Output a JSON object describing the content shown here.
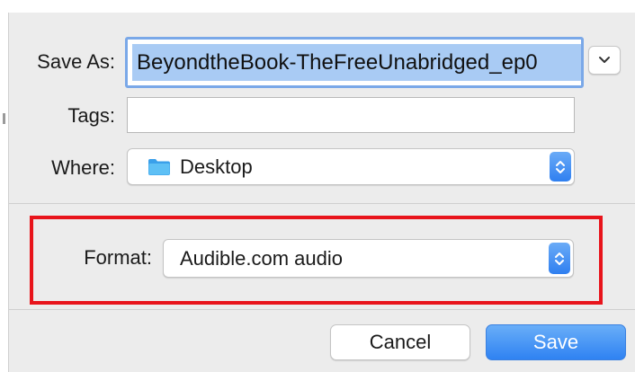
{
  "dialog": {
    "save_as_label": "Save As:",
    "save_as_value": "BeyondtheBook-TheFreeUnabridged_ep0",
    "tags_label": "Tags:",
    "tags_value": "",
    "where_label": "Where:",
    "where_value": "Desktop",
    "where_icon": "folder-icon",
    "format_label": "Format:",
    "format_value": "Audible.com audio"
  },
  "buttons": {
    "cancel_label": "Cancel",
    "save_label": "Save"
  },
  "colors": {
    "accent": "#2f7ff0",
    "selection": "#a9cbf4",
    "highlight_border": "#e8141b",
    "background": "#ececec"
  }
}
